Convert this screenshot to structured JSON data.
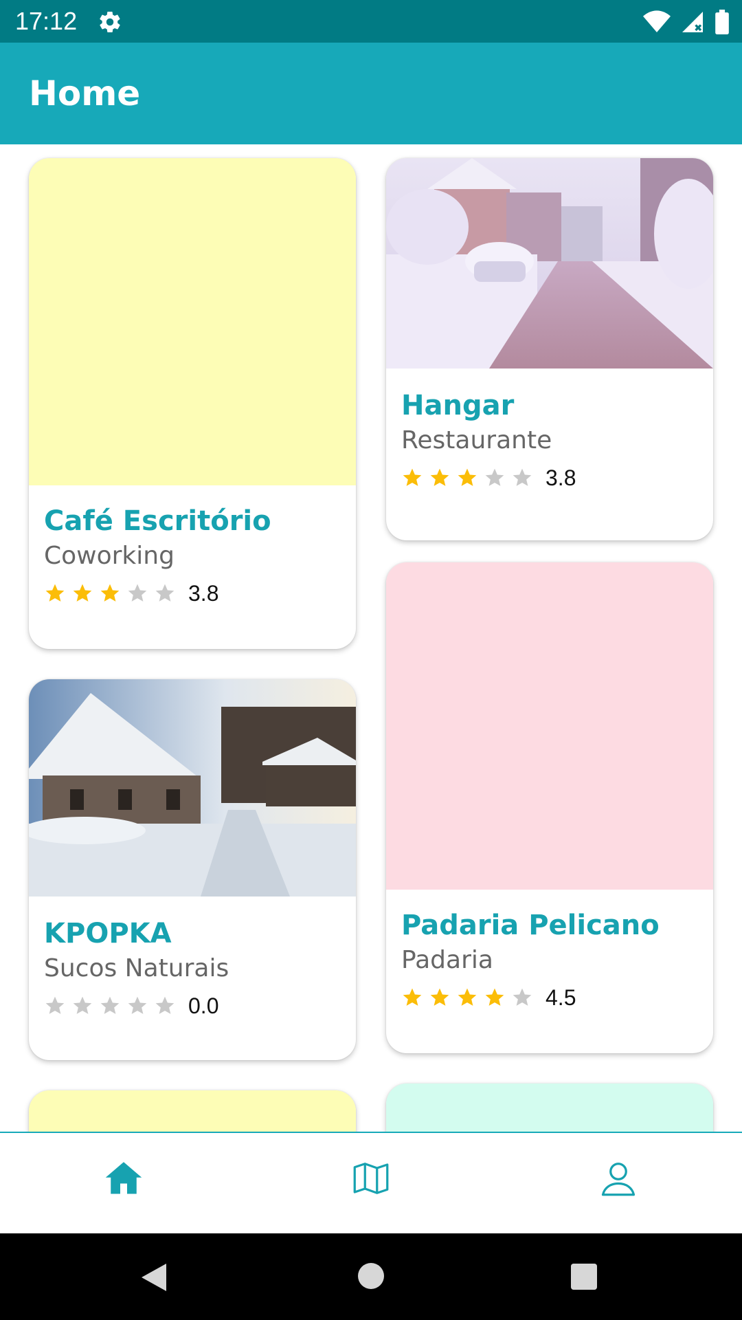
{
  "status": {
    "time": "17:12"
  },
  "appbar": {
    "title": "Home"
  },
  "cards": [
    {
      "title": "Café Escritório",
      "category": "Coworking",
      "rating": "3.8",
      "stars": 3,
      "image": "placeholder-yellow"
    },
    {
      "title": "Hangar",
      "category": "Restaurante",
      "rating": "3.8",
      "stars": 3,
      "image": "snowy-street-photo"
    },
    {
      "title": "KPOPKA",
      "category": "Sucos Naturais",
      "rating": "0.0",
      "stars": 0,
      "image": "snowy-farmhouse-photo"
    },
    {
      "title": "Padaria Pelicano",
      "category": "Padaria",
      "rating": "4.5",
      "stars": 4,
      "image": "placeholder-pink"
    }
  ],
  "colors": {
    "primary": "#17a9b9",
    "status_bar": "#017b84",
    "title_text": "#17a2b0",
    "star_filled": "#fbbd08",
    "star_empty": "#c8c8c8",
    "placeholder_yellow": "#fdfdb6",
    "placeholder_pink": "#fddbe2",
    "placeholder_mint": "#d3fcef"
  },
  "bottom_nav": {
    "items": [
      "home-icon",
      "map-icon",
      "profile-icon"
    ],
    "selected": "home-icon"
  }
}
